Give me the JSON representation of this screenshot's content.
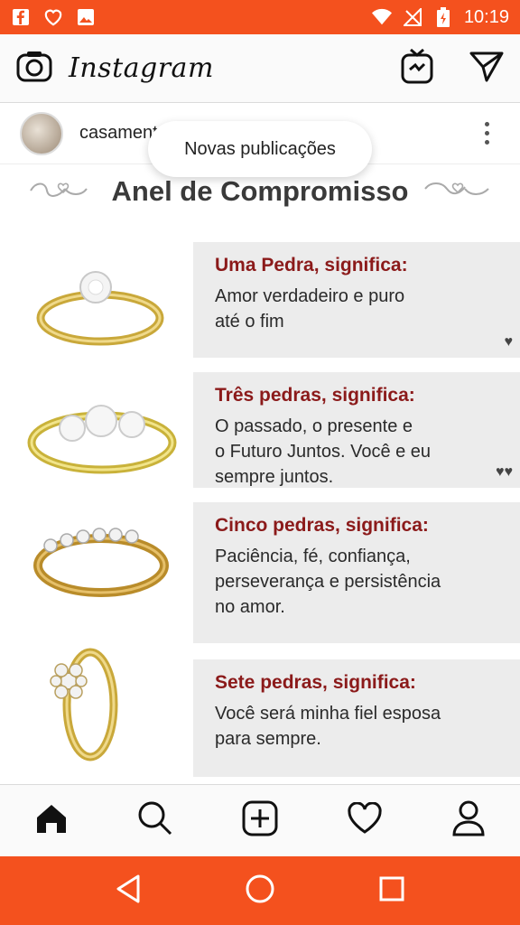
{
  "status_bar": {
    "time": "10:19",
    "icons": [
      "facebook-icon",
      "heart-outline-icon",
      "image-icon",
      "wifi-icon",
      "no-signal-icon",
      "battery-charging-icon"
    ]
  },
  "app_bar": {
    "logo": "Instagram",
    "icons": [
      "camera-icon",
      "igtv-icon",
      "direct-message-icon"
    ]
  },
  "post": {
    "username": "casament",
    "toast": "Novas publicações",
    "image": {
      "title": "Anel de Compromisso",
      "items": [
        {
          "heading": "Uma Pedra, significa:",
          "text_lines": [
            "Amor verdadeiro e puro",
            "até o fim"
          ]
        },
        {
          "heading": "Três pedras, significa:",
          "text_lines": [
            "O passado, o presente e",
            "o Futuro Juntos. Você e eu",
            "sempre juntos."
          ]
        },
        {
          "heading": "Cinco pedras, significa:",
          "text_lines": [
            "Paciência, fé, confiança,",
            "perseverança e persistência",
            "no amor."
          ]
        },
        {
          "heading": "Sete pedras, significa:",
          "text_lines": [
            "Você será minha fiel esposa",
            "para sempre."
          ]
        }
      ]
    }
  },
  "bottom_nav": [
    "home-icon",
    "search-icon",
    "add-post-icon",
    "activity-heart-icon",
    "profile-icon"
  ],
  "android_nav": [
    "back-icon",
    "home-circle-icon",
    "recents-icon"
  ],
  "colors": {
    "status_bar": "#f4511e",
    "heading_red": "#8b1a1a",
    "card_bg": "#ececec"
  }
}
